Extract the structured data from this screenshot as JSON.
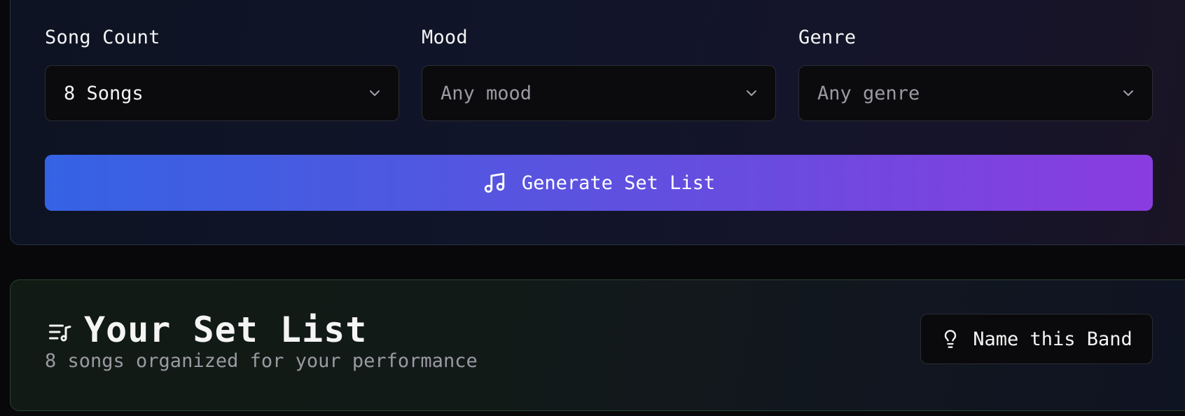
{
  "generator": {
    "song_count": {
      "label": "Song Count",
      "value": "8 Songs"
    },
    "mood": {
      "label": "Mood",
      "placeholder": "Any mood"
    },
    "genre": {
      "label": "Genre",
      "placeholder": "Any genre"
    },
    "generate_button": {
      "label": "Generate Set List",
      "icon": "music-note-icon"
    }
  },
  "set_list": {
    "icon": "list-music-icon",
    "title": "Your Set List",
    "subtitle": "8 songs organized for your performance",
    "name_band_button": {
      "label": "Name this Band",
      "icon": "lightbulb-icon"
    }
  },
  "colors": {
    "accent_gradient_start": "#3562e4",
    "accent_gradient_end": "#8a3ce0",
    "page_background": "#08080a"
  }
}
